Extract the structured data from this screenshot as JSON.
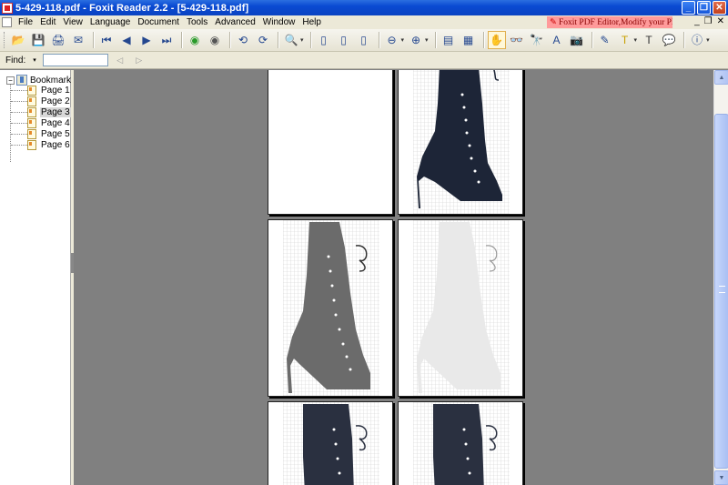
{
  "window": {
    "title": "5-429-118.pdf - Foxit Reader 2.2 - [5-429-118.pdf]",
    "minimize": "_",
    "maximize": "❐",
    "close": "✕"
  },
  "menu": {
    "items": [
      "File",
      "Edit",
      "View",
      "Language",
      "Document",
      "Tools",
      "Advanced",
      "Window",
      "Help"
    ],
    "promo": "Foxit PDF Editor,Modify your PDF!",
    "mdi_minimize": "_",
    "mdi_restore": "❐",
    "mdi_close": "✕"
  },
  "toolbar": {
    "icons": {
      "open": "📂",
      "save": "💾",
      "print": "🖨",
      "email": "✉",
      "first": "⏮",
      "prev": "◀",
      "next": "▶",
      "last": "⏭",
      "go_back": "◉",
      "go_forward": "◉",
      "rotate_left": "⟲",
      "rotate_right": "⟳",
      "zoom": "🔍",
      "page_fit": "▯",
      "fit_width": "▯",
      "fit_visible": "▯",
      "zoom_out": "⊖",
      "zoom_in": "⊕",
      "single_page": "▤",
      "continuous": "▦",
      "hand": "✋",
      "select_text": "👓",
      "find": "🔭",
      "typewriter": "A",
      "snapshot": "📷",
      "pen": "✎",
      "highlight": "T",
      "text_box": "T",
      "note": "💬",
      "info": "ⓘ"
    }
  },
  "find": {
    "label": "Find:",
    "dropdown": "▾",
    "value": "",
    "prev": "◁",
    "next": "▷"
  },
  "bookmarks": {
    "root": "Bookmarks",
    "toggle": "−",
    "items": [
      "Page 1",
      "Page 2",
      "Page 3",
      "Page 4",
      "Page 5",
      "Page 6"
    ],
    "selected_index": 2
  },
  "scrollbar": {
    "up": "▲",
    "down": "▼"
  }
}
